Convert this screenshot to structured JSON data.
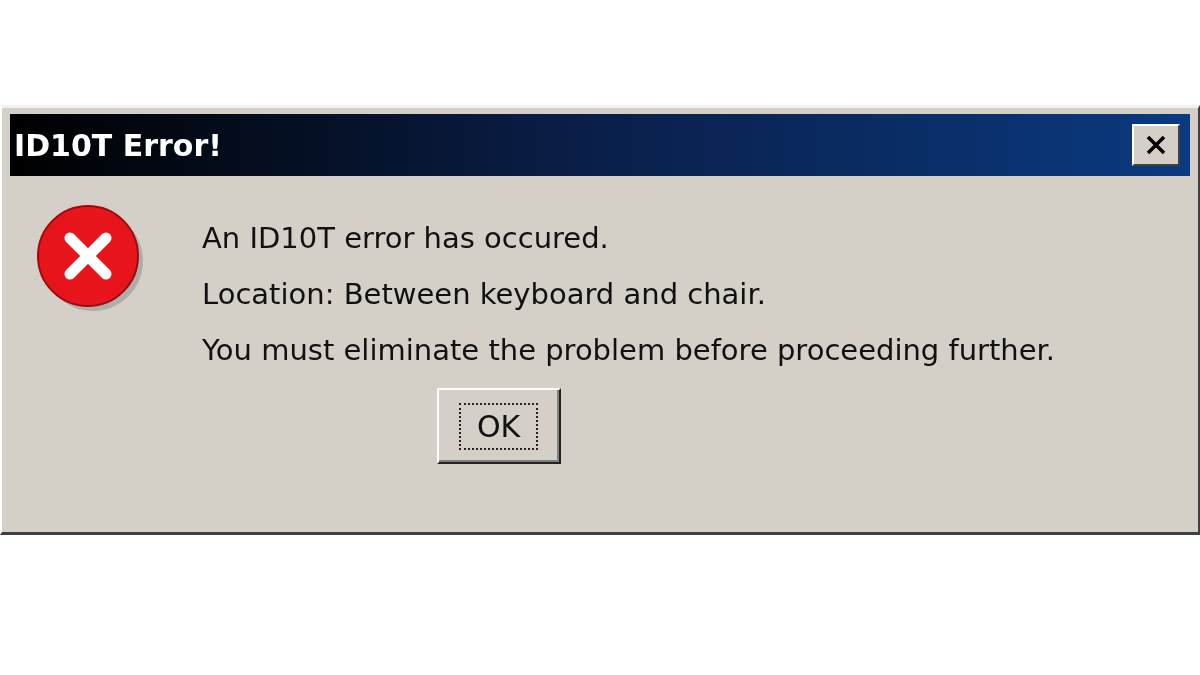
{
  "window": {
    "title": "ID10T Error!"
  },
  "message_lines": [
    "An ID10T error has occured.",
    "Location: Between keyboard and chair.",
    "You must eliminate the problem before proceeding further."
  ],
  "buttons": [
    {
      "label": "OK",
      "focused": true
    }
  ]
}
